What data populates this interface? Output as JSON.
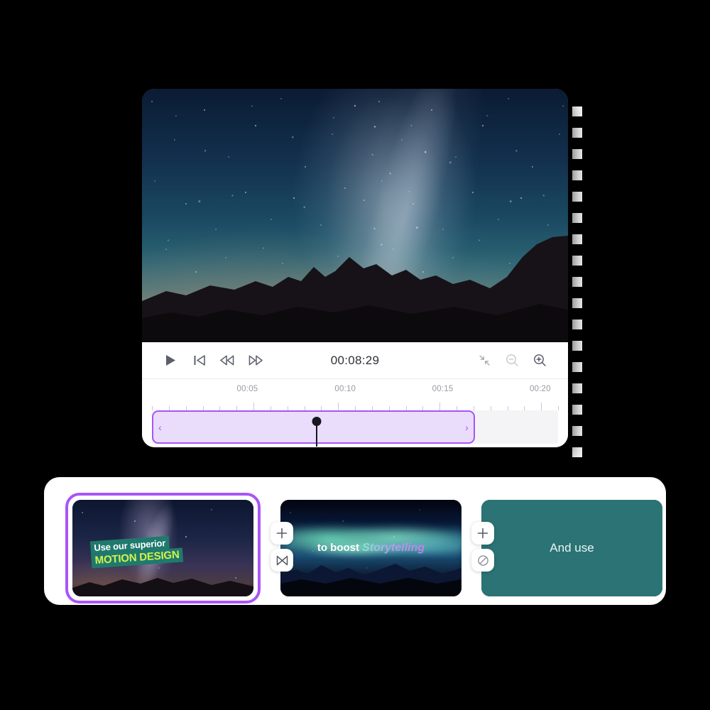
{
  "app": {
    "background_color": "#000000",
    "accent_color": "#a855f7",
    "card_color": "#ffffff"
  },
  "player": {
    "transport": {
      "play_label": "play",
      "skip_start_label": "skip-to-start",
      "rewind_label": "rewind",
      "fast_forward_label": "fast-forward",
      "timecode": "00:08:29",
      "fit_label": "fit-to-screen",
      "zoom_out_label": "zoom-out",
      "zoom_in_label": "zoom-in"
    },
    "timeline": {
      "ruler_labels": [
        "00:05",
        "00:10",
        "00:15",
        "00:20"
      ],
      "ruler_label_positions_pct": [
        23.5,
        47.6,
        71.6,
        95.6
      ],
      "tick_count": 24,
      "clip_range_width_pct": 79.5,
      "playhead_position_pct": 40.3,
      "handle_left": "‹",
      "handle_right": "›"
    }
  },
  "clip_strip": {
    "clips": [
      {
        "id": "clip-1",
        "selected": true,
        "thumb_type": "galaxy",
        "caption_line1": "Use our superior",
        "caption_line2": "MOTION DESIGN",
        "caption_bg": "#1f7a6e",
        "caption_line2_color": "#d4f24a"
      },
      {
        "id": "clip-2",
        "selected": false,
        "thumb_type": "aurora",
        "caption_line1": "to boost ",
        "caption_line2": "Storytelling"
      },
      {
        "id": "clip-3",
        "selected": false,
        "thumb_type": "solid",
        "thumb_color": "#2b7374",
        "caption_line1": "And use",
        "caption_line2": ""
      }
    ],
    "actions": [
      {
        "id": "add-1",
        "icon": "plus-icon",
        "glyph": "+"
      },
      {
        "id": "transition-1",
        "icon": "transition-icon",
        "glyph": "⋈"
      },
      {
        "id": "add-2",
        "icon": "plus-icon",
        "glyph": "+"
      },
      {
        "id": "no-transition-2",
        "icon": "no-transition-icon",
        "glyph": "⊘"
      },
      {
        "id": "add-3",
        "icon": "plus-icon",
        "glyph": "+"
      },
      {
        "id": "no-transition-3",
        "icon": "no-transition-icon",
        "glyph": "⊘"
      }
    ]
  }
}
